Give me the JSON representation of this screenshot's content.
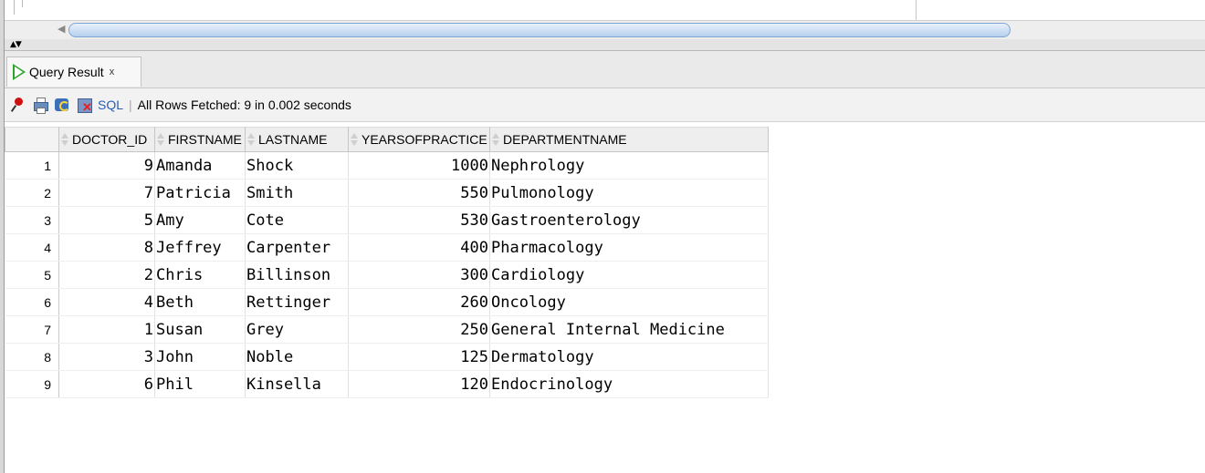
{
  "tab": {
    "label": "Query Result",
    "close": "x"
  },
  "toolbar": {
    "sql_label": "SQL",
    "separator": "|",
    "status": "All Rows Fetched: 9 in 0.002 seconds"
  },
  "grid": {
    "headers": [
      "DOCTOR_ID",
      "FIRSTNAME",
      "LASTNAME",
      "YEARSOFPRACTICE",
      "DEPARTMENTNAME"
    ],
    "rows": [
      {
        "n": "1",
        "doctor_id": "9",
        "firstname": "Amanda",
        "lastname": "Shock",
        "years": "1000",
        "department": "Nephrology"
      },
      {
        "n": "2",
        "doctor_id": "7",
        "firstname": "Patricia",
        "lastname": "Smith",
        "years": "550",
        "department": "Pulmonology"
      },
      {
        "n": "3",
        "doctor_id": "5",
        "firstname": "Amy",
        "lastname": "Cote",
        "years": "530",
        "department": "Gastroenterology"
      },
      {
        "n": "4",
        "doctor_id": "8",
        "firstname": "Jeffrey",
        "lastname": "Carpenter",
        "years": "400",
        "department": "Pharmacology"
      },
      {
        "n": "5",
        "doctor_id": "2",
        "firstname": "Chris",
        "lastname": "Billinson",
        "years": "300",
        "department": "Cardiology"
      },
      {
        "n": "6",
        "doctor_id": "4",
        "firstname": "Beth",
        "lastname": "Rettinger",
        "years": "260",
        "department": "Oncology"
      },
      {
        "n": "7",
        "doctor_id": "1",
        "firstname": "Susan",
        "lastname": "Grey",
        "years": "250",
        "department": "General Internal Medicine"
      },
      {
        "n": "8",
        "doctor_id": "3",
        "firstname": "John",
        "lastname": "Noble",
        "years": "125",
        "department": "Dermatology"
      },
      {
        "n": "9",
        "doctor_id": "6",
        "firstname": "Phil",
        "lastname": "Kinsella",
        "years": "120",
        "department": "Endocrinology"
      }
    ]
  },
  "icons": {
    "pin": "pin-icon",
    "print": "print-icon",
    "refresh": "refresh-icon",
    "sql_cancel": "sql-cancel-icon",
    "run": "run-statement-icon",
    "sort": "sort-icon"
  },
  "colors": {
    "run_green": "#2ea32e",
    "sql_link": "#2a5db0",
    "pin_red": "#d01010"
  }
}
